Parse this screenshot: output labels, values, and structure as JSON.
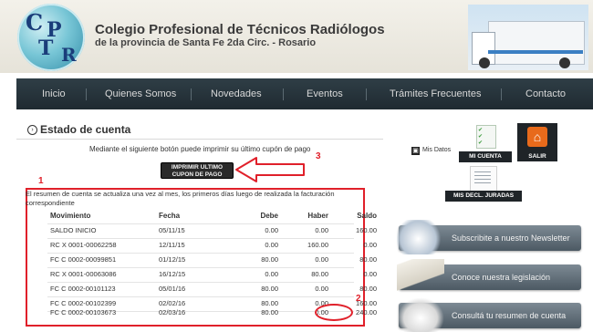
{
  "header": {
    "logo_letters": [
      "C",
      "P",
      "T",
      "R"
    ],
    "title": "Colegio Profesional de Técnicos Radiólogos",
    "subtitle": "de la provincia de Santa Fe 2da Circ. - Rosario"
  },
  "nav": {
    "items": [
      "Inicio",
      "Quienes Somos",
      "Novedades",
      "Eventos",
      "Trámites Frecuentes",
      "Contacto"
    ]
  },
  "estado": {
    "title": "Estado de cuenta",
    "print_text": "Mediante el siguiente botón puede imprimir su último cupón de pago",
    "print_button_line1": "IMPRIMIR ULTIMO",
    "print_button_line2": "CUPON DE PAGO",
    "resumen_note": "El resumen de cuenta se actualiza una vez al mes, los primeros días luego de realizada la facturación correspondiente"
  },
  "annotations": {
    "n1": "1",
    "n2": "2",
    "n3": "3",
    "color": "#e0202a"
  },
  "table": {
    "headers": [
      "Movimiento",
      "Fecha",
      "Debe",
      "Haber",
      "Saldo"
    ],
    "rows": [
      [
        "SALDO INICIO",
        "05/11/15",
        "0.00",
        "0.00",
        "160.00"
      ],
      [
        "RC X 0001-00062258",
        "12/11/15",
        "0.00",
        "160.00",
        "0.00"
      ],
      [
        "FC C 0002-00099851",
        "01/12/15",
        "80.00",
        "0.00",
        "80.00"
      ],
      [
        "RC X 0001-00063086",
        "16/12/15",
        "0.00",
        "80.00",
        "0.00"
      ],
      [
        "FC C 0002-00101123",
        "05/01/16",
        "80.00",
        "0.00",
        "80.00"
      ],
      [
        "FC C 0002-00102399",
        "02/02/16",
        "80.00",
        "0.00",
        "160.00"
      ],
      [
        "FC C 0002-00103673",
        "02/03/16",
        "80.00",
        "0.00",
        "240.00"
      ]
    ]
  },
  "sidebar": {
    "mis_datos": "Mis Datos",
    "mi_cuenta": "MI CUENTA",
    "salir": "SALIR",
    "decl": "MIS DECL. JURADAS",
    "banners": [
      "Subscribite a nuestro Newsletter",
      "Conoce nuestra legislación",
      "Consultá tu resumen de cuenta"
    ]
  },
  "colors": {
    "nav_bg": "#243138",
    "salir_orange": "#e86a1b",
    "annotation_red": "#e0202a"
  }
}
